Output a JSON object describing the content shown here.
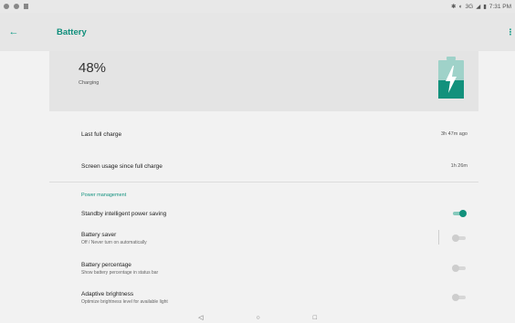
{
  "status_bar": {
    "network": "3G",
    "battery_text": "",
    "time": "7:31 PM"
  },
  "app_bar": {
    "title": "Battery"
  },
  "hero": {
    "level_text": "48%",
    "level_percent": 48,
    "status": "Charging",
    "accent_color": "#12917c",
    "empty_color": "#9fd2c9"
  },
  "stats": [
    {
      "label": "Last full charge",
      "value": "3h 47m ago"
    },
    {
      "label": "Screen usage since full charge",
      "value": "1h 26m"
    }
  ],
  "power_management": {
    "header": "Power management",
    "items": [
      {
        "title": "Standby intelligent power saving",
        "subtitle": "",
        "enabled": true
      },
      {
        "title": "Battery saver",
        "subtitle": "Off / Never turn on automatically",
        "enabled": false
      },
      {
        "title": "Battery percentage",
        "subtitle": "Show battery percentage in status bar",
        "enabled": false
      },
      {
        "title": "Adaptive brightness",
        "subtitle": "Optimize brightness level for available light",
        "enabled": false
      }
    ]
  },
  "icons": {
    "back": "arrow-left-icon",
    "overflow": "more-vert-icon",
    "nav_back": "triangle-back-icon",
    "nav_home": "circle-home-icon",
    "nav_recents": "square-recents-icon"
  }
}
